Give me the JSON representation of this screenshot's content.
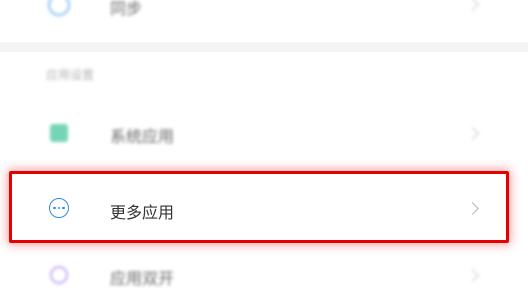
{
  "rows": [
    {
      "label": "同步",
      "icon": "sync-icon"
    },
    {
      "label": "系统应用",
      "icon": "system-apps-icon"
    },
    {
      "label": "更多应用",
      "icon": "more-dots-icon"
    },
    {
      "label": "应用双开",
      "icon": "dual-apps-icon"
    }
  ],
  "section": {
    "label": "应用设置"
  },
  "colors": {
    "highlight": "#e60000",
    "more_icon": "#2f8be6",
    "sync_icon": "#5aa9f2",
    "system_icon": "#46c6a0",
    "dual_icon": "#b08cf0"
  }
}
